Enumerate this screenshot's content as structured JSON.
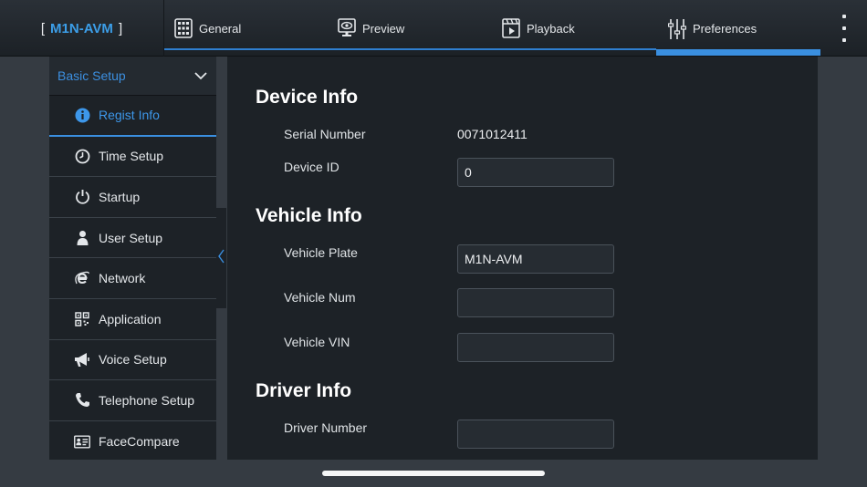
{
  "header": {
    "brand_open": "[",
    "brand_name": "M1N-AVM",
    "brand_close": "]",
    "tabs": [
      {
        "label": "General",
        "icon": "general-grid-icon"
      },
      {
        "label": "Preview",
        "icon": "preview-monitor-icon"
      },
      {
        "label": "Playback",
        "icon": "playback-clapper-icon"
      },
      {
        "label": "Preferences",
        "icon": "preferences-sliders-icon"
      }
    ],
    "active_tab": "Preferences"
  },
  "sidebar": {
    "header_label": "Basic Setup",
    "items": [
      {
        "label": "Regist Info",
        "icon": "info-icon"
      },
      {
        "label": "Time Setup",
        "icon": "clock-icon"
      },
      {
        "label": "Startup",
        "icon": "power-icon"
      },
      {
        "label": "User Setup",
        "icon": "user-icon"
      },
      {
        "label": "Network",
        "icon": "network-e-icon"
      },
      {
        "label": "Application",
        "icon": "qr-code-icon"
      },
      {
        "label": "Voice Setup",
        "icon": "megaphone-icon"
      },
      {
        "label": "Telephone Setup",
        "icon": "phone-icon"
      },
      {
        "label": "FaceCompare",
        "icon": "id-card-icon"
      }
    ],
    "active_item": "Regist Info"
  },
  "main": {
    "device_info": {
      "title": "Device Info",
      "serial_label": "Serial Number",
      "serial_value": "0071012411",
      "device_id_label": "Device ID",
      "device_id_value": "0"
    },
    "vehicle_info": {
      "title": "Vehicle Info",
      "plate_label": "Vehicle Plate",
      "plate_value": "M1N-AVM",
      "num_label": "Vehicle Num",
      "num_value": "",
      "vin_label": "Vehicle VIN",
      "vin_value": ""
    },
    "driver_info": {
      "title": "Driver Info",
      "number_label": "Driver Number",
      "number_value": ""
    }
  },
  "colors": {
    "accent": "#3a8fe0",
    "panel": "#1d2227",
    "background": "#353b42"
  }
}
